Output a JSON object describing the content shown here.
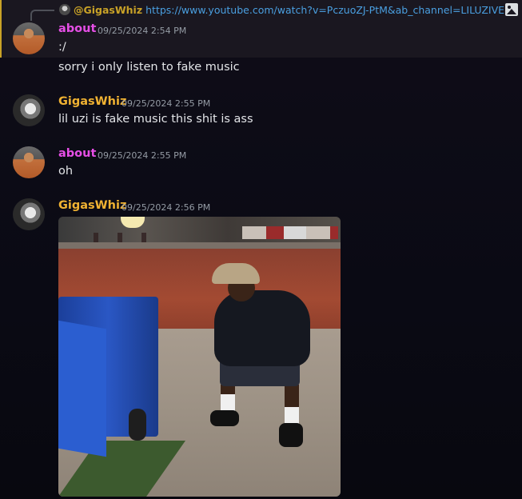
{
  "reply": {
    "mention": "@GigasWhiz",
    "link": "https://www.youtube.com/watch?v=PczuoZJ-PtM&ab_channel=LILUZIVERT"
  },
  "messages": [
    {
      "author": "about",
      "time": "09/25/2024 2:54 PM",
      "lines": [
        ":/",
        "sorry i only listen to fake music"
      ]
    },
    {
      "author": "GigasWhiz",
      "time": "09/25/2024 2:55 PM",
      "lines": [
        "lil uzi is fake music this shit is ass"
      ]
    },
    {
      "author": "about",
      "time": "09/25/2024 2:55 PM",
      "lines": [
        "oh"
      ]
    },
    {
      "author": "GigasWhiz",
      "time": "09/25/2024 2:56 PM",
      "lines": []
    }
  ],
  "colors": {
    "about_name": "#e64fe6",
    "gigas_name": "#f0b232",
    "link": "#4a9fe0",
    "highlight_bar": "#c9a227"
  },
  "icons": {
    "attachment": "image-icon",
    "reply_avatar": "mini-avatar"
  }
}
